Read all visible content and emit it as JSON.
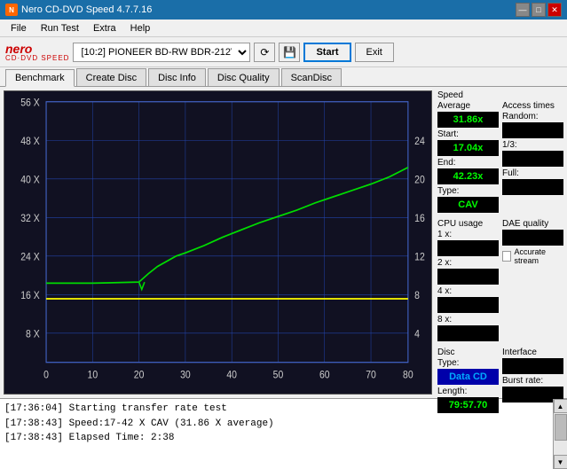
{
  "titlebar": {
    "title": "Nero CD-DVD Speed 4.7.7.16",
    "controls": [
      "—",
      "□",
      "✕"
    ]
  },
  "menu": {
    "items": [
      "File",
      "Run Test",
      "Extra",
      "Help"
    ]
  },
  "toolbar": {
    "drive_label": "[10:2] PIONEER BD-RW BDR-212V 1.00",
    "start_label": "Start",
    "exit_label": "Exit"
  },
  "tabs": {
    "items": [
      "Benchmark",
      "Create Disc",
      "Disc Info",
      "Disc Quality",
      "ScanDisc"
    ],
    "active": 0
  },
  "speed_panel": {
    "title": "Speed",
    "average_label": "Average",
    "average_value": "31.86x",
    "start_label": "Start:",
    "start_value": "17.04x",
    "end_label": "End:",
    "end_value": "42.23x",
    "type_label": "Type:",
    "type_value": "CAV"
  },
  "access_times": {
    "title": "Access times",
    "random_label": "Random:",
    "random_value": "",
    "onethird_label": "1/3:",
    "onethird_value": "",
    "full_label": "Full:",
    "full_value": ""
  },
  "cpu_usage": {
    "title": "CPU usage",
    "1x_label": "1 x:",
    "1x_value": "",
    "2x_label": "2 x:",
    "2x_value": "",
    "4x_label": "4 x:",
    "4x_value": "",
    "8x_label": "8 x:",
    "8x_value": ""
  },
  "dae_quality": {
    "title": "DAE quality",
    "value": "",
    "accurate_stream_label": "Accurate stream",
    "accurate_stream_checked": false
  },
  "disc": {
    "type_title": "Disc",
    "type_label": "Type:",
    "type_value": "Data CD",
    "length_label": "Length:",
    "length_value": "79:57.70",
    "interface_label": "Interface",
    "interface_value": "",
    "burst_label": "Burst rate:",
    "burst_value": ""
  },
  "chart": {
    "y_labels_left": [
      "56 X",
      "48 X",
      "40 X",
      "32 X",
      "24 X",
      "16 X",
      "8 X"
    ],
    "y_labels_right": [
      "24",
      "20",
      "16",
      "12",
      "8",
      "4"
    ],
    "x_labels": [
      "0",
      "10",
      "20",
      "30",
      "40",
      "50",
      "60",
      "70",
      "80"
    ]
  },
  "log": {
    "entries": [
      "[17:36:04]  Starting transfer rate test",
      "[17:38:43]  Speed:17-42 X CAV (31.86 X average)",
      "[17:38:43]  Elapsed Time: 2:38"
    ]
  }
}
